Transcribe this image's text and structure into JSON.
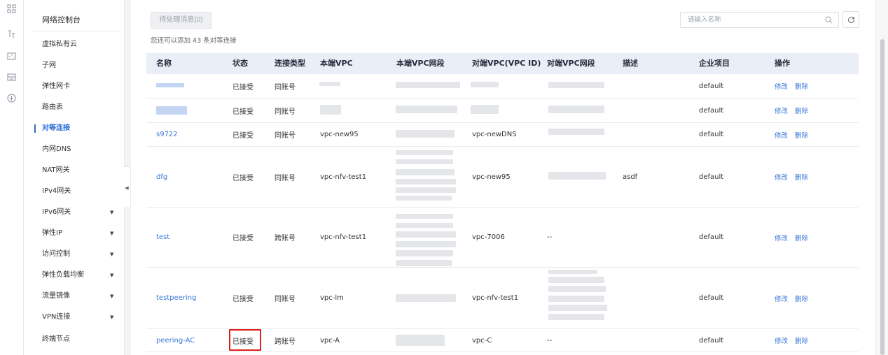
{
  "rail": {
    "icons": [
      "grid-apps-icon",
      "topology-icon",
      "network-card-icon",
      "router-icon",
      "globe-icon"
    ]
  },
  "sidebar": {
    "title": "网络控制台",
    "items": [
      {
        "label": "虚拟私有云",
        "active": false,
        "expandable": false
      },
      {
        "label": "子网",
        "active": false,
        "expandable": false
      },
      {
        "label": "弹性网卡",
        "active": false,
        "expandable": false
      },
      {
        "label": "路由表",
        "active": false,
        "expandable": false
      },
      {
        "label": "对等连接",
        "active": true,
        "expandable": false
      },
      {
        "label": "内网DNS",
        "active": false,
        "expandable": false
      },
      {
        "label": "NAT网关",
        "active": false,
        "expandable": false
      },
      {
        "label": "IPv4网关",
        "active": false,
        "expandable": false
      },
      {
        "label": "IPv6网关",
        "active": false,
        "expandable": true
      },
      {
        "label": "弹性IP",
        "active": false,
        "expandable": true
      },
      {
        "label": "访问控制",
        "active": false,
        "expandable": true
      },
      {
        "label": "弹性负载均衡",
        "active": false,
        "expandable": true
      },
      {
        "label": "流量镜像",
        "active": false,
        "expandable": true
      },
      {
        "label": "VPN连接",
        "active": false,
        "expandable": true
      },
      {
        "label": "终端节点",
        "active": false,
        "expandable": false
      }
    ]
  },
  "toolbar": {
    "pending_label": "待处理消息(0)",
    "quota_text": "您还可以添加 43 条对等连接",
    "search_placeholder": "请输入名称",
    "search_value": ""
  },
  "table": {
    "headers": [
      "名称",
      "状态",
      "连接类型",
      "本端VPC",
      "本端VPC网段",
      "对端VPC(VPC ID)",
      "对端VPC网段",
      "描述",
      "企业项目",
      "操作"
    ],
    "rows": [
      {
        "name": "",
        "status": "已接受",
        "type": "同账号",
        "local_vpc": "",
        "peer_vpc": "",
        "peer_cidr": "",
        "desc": "",
        "project": "default",
        "ops": [
          "修改",
          "删除"
        ]
      },
      {
        "name": "",
        "status": "已接受",
        "type": "同账号",
        "local_vpc": "",
        "peer_vpc": "",
        "peer_cidr": "",
        "desc": "",
        "project": "default",
        "ops": [
          "修改",
          "删除"
        ]
      },
      {
        "name": "s9722",
        "status": "已接受",
        "type": "同账号",
        "local_vpc": "vpc-new95",
        "peer_vpc": "vpc-newDNS",
        "peer_cidr": "",
        "desc": "",
        "project": "default",
        "ops": [
          "修改",
          "删除"
        ]
      },
      {
        "name": "dfg",
        "status": "已接受",
        "type": "同账号",
        "local_vpc": "vpc-nfv-test1",
        "peer_vpc": "vpc-new95",
        "peer_cidr": "",
        "desc": "asdf",
        "project": "default",
        "ops": [
          "修改",
          "删除"
        ]
      },
      {
        "name": "test",
        "status": "已接受",
        "type": "跨账号",
        "local_vpc": "vpc-nfv-test1",
        "peer_vpc": "vpc-7006",
        "peer_cidr": "--",
        "desc": "",
        "project": "default",
        "ops": [
          "修改",
          "删除"
        ]
      },
      {
        "name": "testpeering",
        "status": "已接受",
        "type": "同账号",
        "local_vpc": "vpc-lm",
        "peer_vpc": "vpc-nfv-test1",
        "peer_cidr": "",
        "desc": "",
        "project": "default",
        "ops": [
          "修改",
          "删除"
        ]
      },
      {
        "name": "peering-AC",
        "status": "已接受",
        "type": "跨账号",
        "local_vpc": "vpc-A",
        "peer_vpc": "vpc-C",
        "peer_cidr": "--",
        "desc": "",
        "project": "default",
        "ops": [
          "修改",
          "删除"
        ]
      }
    ]
  },
  "colors": {
    "accent": "#3b78d8",
    "active_nav": "#2f6fd8",
    "header_bg": "#eaeef7",
    "highlight": "#e02020"
  }
}
